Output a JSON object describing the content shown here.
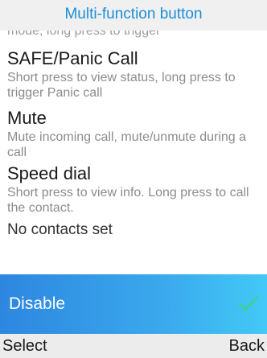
{
  "header": {
    "title": "Multi-function button"
  },
  "list": {
    "cut_text": "mode, long press to trigger",
    "items": [
      {
        "label": "SAFE/Panic Call",
        "desc": "Short press to view status, long press to trigger Panic call"
      },
      {
        "label": "Mute",
        "desc": "Mute incoming call, mute/unmute during a call"
      },
      {
        "label": "Speed dial",
        "desc": "Short press to view info. Long press to call the contact.",
        "extra": "No contacts set"
      }
    ]
  },
  "selected": {
    "label": "Disable",
    "icon": "check-icon",
    "icon_color": "#3ed486"
  },
  "softkeys": {
    "left": "Select",
    "right": "Back"
  },
  "colors": {
    "accent": "#1a8fd6",
    "selected_start": "#2d87e0",
    "selected_end": "#42c9f6"
  }
}
